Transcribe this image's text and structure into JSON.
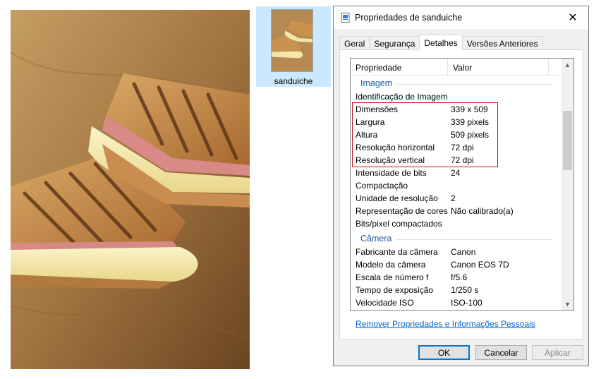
{
  "file": {
    "thumbnail_name": "sanduiche"
  },
  "dialog": {
    "title": "Propriedades de sanduiche",
    "tabs": [
      {
        "label": "Geral",
        "active": false
      },
      {
        "label": "Segurança",
        "active": false
      },
      {
        "label": "Detalhes",
        "active": true
      },
      {
        "label": "Versões Anteriores",
        "active": false
      }
    ],
    "columns": {
      "property": "Propriedade",
      "value": "Valor"
    },
    "groups": {
      "image": "Imagem",
      "camera": "Câmera"
    },
    "image_rows": [
      {
        "key": "Identificação de Imagem",
        "value": ""
      },
      {
        "key": "Dimensões",
        "value": "339 x 509"
      },
      {
        "key": "Largura",
        "value": "339 pixels"
      },
      {
        "key": "Altura",
        "value": "509 pixels"
      },
      {
        "key": "Resolução horizontal",
        "value": "72 dpi"
      },
      {
        "key": "Resolução vertical",
        "value": "72 dpi"
      },
      {
        "key": "Intensidade de bits",
        "value": "24"
      },
      {
        "key": "Compactação",
        "value": ""
      },
      {
        "key": "Unidade de resolução",
        "value": "2"
      },
      {
        "key": "Representação de cores",
        "value": "Não calibrado(a)"
      },
      {
        "key": "Bits/pixel compactados",
        "value": ""
      }
    ],
    "camera_rows": [
      {
        "key": "Fabricante da câmera",
        "value": "Canon"
      },
      {
        "key": "Modelo da câmera",
        "value": "Canon EOS 7D"
      },
      {
        "key": "Escala de número f",
        "value": "f/5.6"
      },
      {
        "key": "Tempo de exposição",
        "value": "1/250 s"
      },
      {
        "key": "Velocidade ISO",
        "value": "ISO-100"
      }
    ],
    "remove_link": "Remover Propriedades e Informações Pessoais",
    "buttons": {
      "ok": "OK",
      "cancel": "Cancelar",
      "apply": "Aplicar"
    }
  },
  "colors": {
    "highlight_border": "#c8101a",
    "link": "#0066cc",
    "group_heading": "#1e5aa8",
    "selected_tile": "#cce8ff"
  },
  "icons": [
    "sandwich-photo",
    "sandwich-thumbnail-icon",
    "image-file-icon",
    "close-icon",
    "scroll-up-icon",
    "scroll-down-icon"
  ]
}
